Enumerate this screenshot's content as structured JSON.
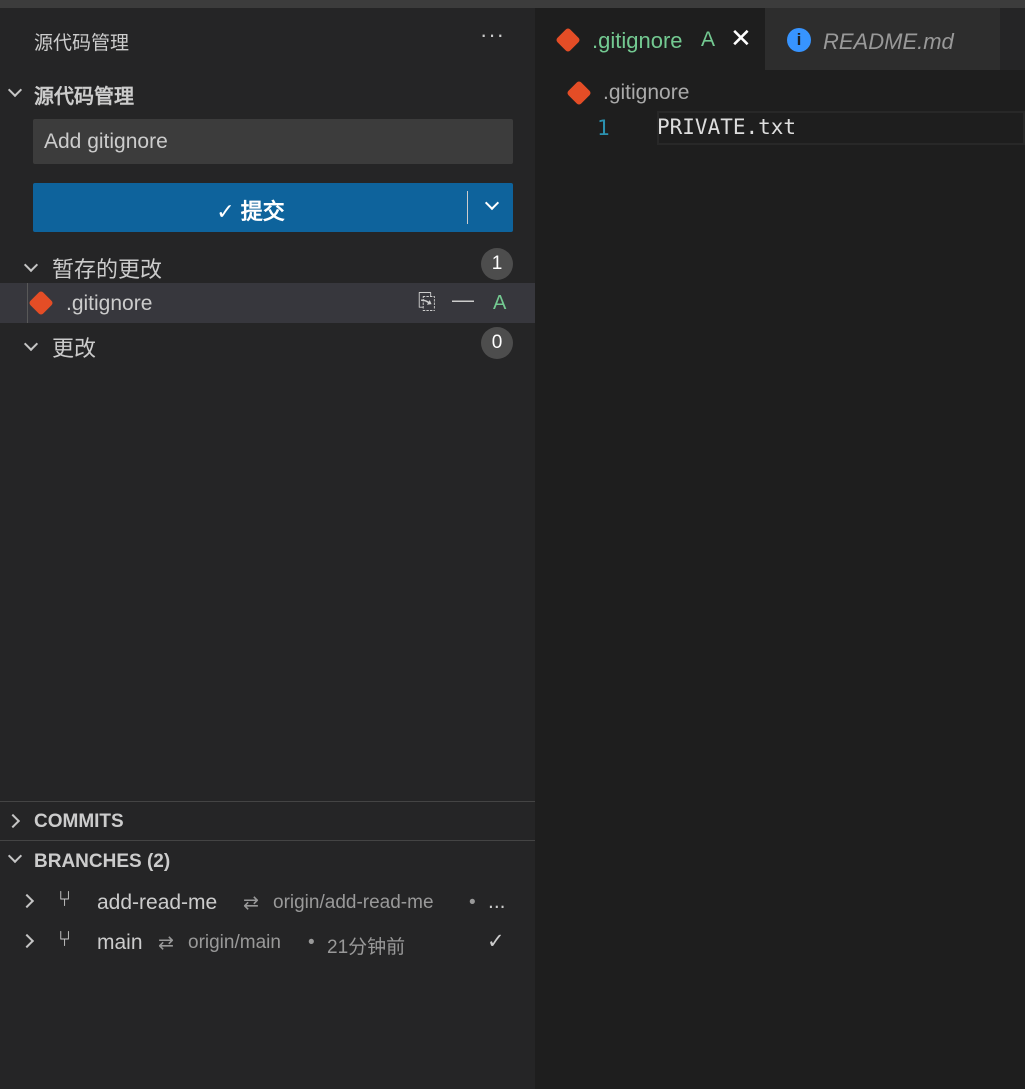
{
  "sidebar": {
    "title": "源代码管理",
    "more_icon": "ellipsis-icon",
    "section_title": "源代码管理",
    "commit_message": "Add gitignore",
    "commit_button": "✓ 提交",
    "staged": {
      "label": "暂存的更改",
      "count": "1",
      "files": [
        {
          "name": ".gitignore",
          "status": "A"
        }
      ]
    },
    "changes": {
      "label": "更改",
      "count": "0"
    },
    "commits_label": "COMMITS",
    "branches_label": "BRANCHES (2)",
    "branches": [
      {
        "name": "add-read-me",
        "upstream": "origin/add-read-me",
        "sync": "⇄",
        "dot": "•",
        "extra": "..."
      },
      {
        "name": "main",
        "upstream": "origin/main",
        "sync": "⇄",
        "dot": "•",
        "time": "21分钟前",
        "mark": "✓"
      }
    ]
  },
  "tabs": [
    {
      "label": ".gitignore",
      "status": "A",
      "active": true,
      "color": "#73c991"
    },
    {
      "label": "README.md",
      "active": false
    }
  ],
  "editor": {
    "breadcrumb": ".gitignore",
    "lines": [
      {
        "number": "1",
        "text": "PRIVATE.txt"
      }
    ]
  },
  "colors": {
    "accent": "#0e639c",
    "git": "#e44d26",
    "added": "#73c991",
    "info": "#3794ff"
  }
}
